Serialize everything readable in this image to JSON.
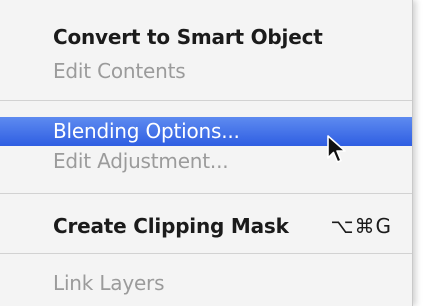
{
  "menu": {
    "items": [
      {
        "label": "Convert to Smart Object",
        "enabled": true
      },
      {
        "label": "Edit Contents",
        "enabled": false
      },
      {
        "label": "Blending Options...",
        "enabled": true,
        "highlighted": true
      },
      {
        "label": "Edit Adjustment...",
        "enabled": false
      },
      {
        "label": "Create Clipping Mask",
        "enabled": true,
        "shortcut": "⌥⌘G"
      },
      {
        "label": "Link Layers",
        "enabled": false
      }
    ]
  },
  "colors": {
    "highlight": "#3d6ce8",
    "disabled_text": "#9b9b9b",
    "enabled_text": "#1b1b1b",
    "menu_background": "#f4f4f4"
  },
  "icons": {
    "cursor": "arrow-pointer-icon"
  }
}
